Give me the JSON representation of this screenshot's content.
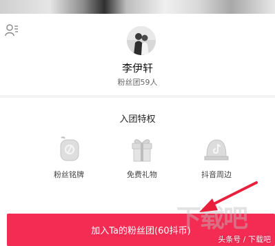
{
  "profile": {
    "name": "李伊轩",
    "fan_count": "粉丝团59人"
  },
  "privileges": {
    "title": "入团特权",
    "items": [
      {
        "label": "粉丝铭牌",
        "icon": "name-tag-icon"
      },
      {
        "label": "免费礼物",
        "icon": "gift-icon"
      },
      {
        "label": "抖音周边",
        "icon": "douyin-cap-icon"
      }
    ]
  },
  "join_button": {
    "label": "加入Ta的粉丝团(60抖币)"
  },
  "watermark": {
    "text": "头条号 / 下载吧",
    "logo": "下载吧"
  },
  "colors": {
    "accent": "#f42b53",
    "arrow": "#e8203c"
  }
}
